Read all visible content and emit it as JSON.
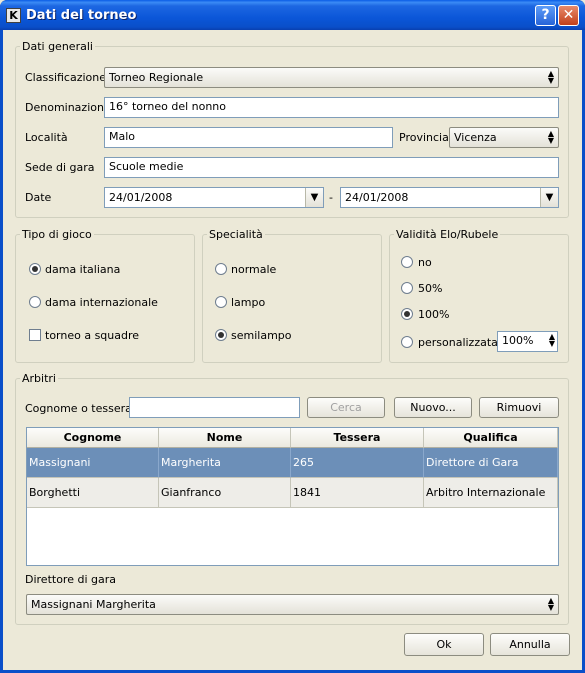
{
  "window": {
    "title": "Dati del torneo",
    "app_icon": "K",
    "help_label": "?",
    "close_label": "✕"
  },
  "general": {
    "legend": "Dati generali",
    "classificazione_label": "Classificazione",
    "classificazione_value": "Torneo Regionale",
    "denominazione_label": "Denominazione",
    "denominazione_value": "16° torneo del nonno",
    "localita_label": "Località",
    "localita_value": "Malo",
    "provincia_label": "Provincia",
    "provincia_value": "Vicenza",
    "sede_label": "Sede di gara",
    "sede_value": "Scuole medie",
    "date_label": "Date",
    "date_from": "24/01/2008",
    "date_sep": "-",
    "date_to": "24/01/2008"
  },
  "tipo": {
    "legend": "Tipo di gioco",
    "options": [
      "dama italiana",
      "dama internazionale"
    ],
    "selected": 0,
    "squadre_label": "torneo a squadre"
  },
  "specialita": {
    "legend": "Specialità",
    "options": [
      "normale",
      "lampo",
      "semilampo"
    ],
    "selected": 2
  },
  "validita": {
    "legend": "Validità Elo/Rubele",
    "options": [
      "no",
      "50%",
      "100%",
      "personalizzata"
    ],
    "selected": 2,
    "custom_value": "100%"
  },
  "arbitri": {
    "legend": "Arbitri",
    "search_label": "Cognome o tessera:",
    "search_value": "",
    "cerca_label": "Cerca",
    "nuovo_label": "Nuovo...",
    "rimuovi_label": "Rimuovi",
    "columns": [
      "Cognome",
      "Nome",
      "Tessera",
      "Qualifica"
    ],
    "rows": [
      [
        "Massignani",
        "Margherita",
        "265",
        "Direttore di Gara"
      ],
      [
        "Borghetti",
        "Gianfranco",
        "1841",
        "Arbitro Internazionale"
      ]
    ],
    "selected_row": 0,
    "direttore_label": "Direttore di gara",
    "direttore_value": "Massignani Margherita"
  },
  "footer": {
    "ok_label": "Ok",
    "annulla_label": "Annulla"
  }
}
